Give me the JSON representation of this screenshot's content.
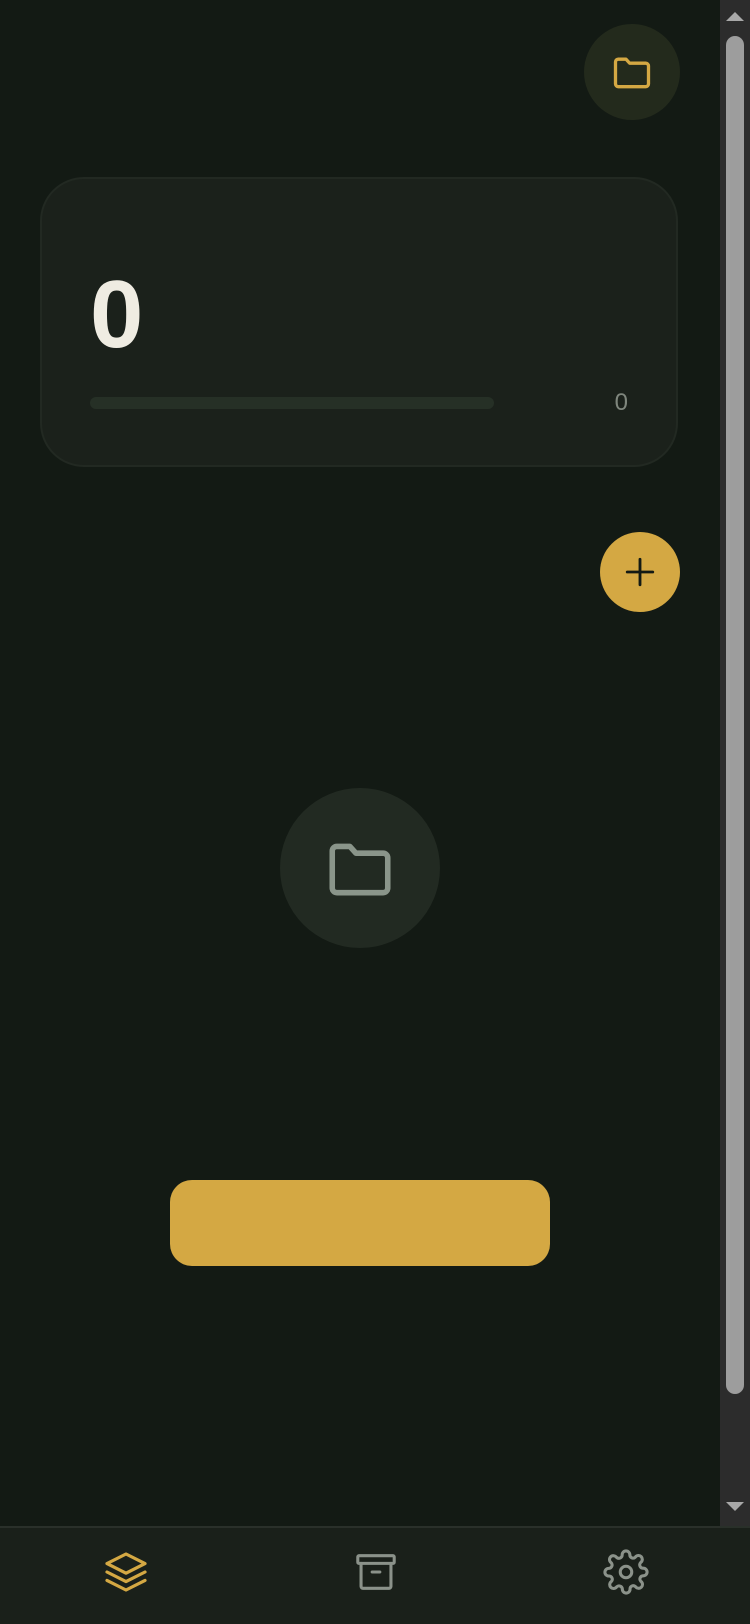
{
  "stats": {
    "count": "0",
    "progress_value": "0",
    "progress_fraction": 0
  },
  "actions": {
    "primary_button_label": ""
  },
  "icons": {
    "top_button": "folder-icon",
    "fab": "plus-icon",
    "empty_state": "folder-icon",
    "nav": [
      "layers-icon",
      "archive-icon",
      "gear-icon"
    ]
  },
  "colors": {
    "background": "#131a14",
    "card": "#1b211b",
    "accent": "#d4a843",
    "muted": "#7f867d",
    "text": "#efece2"
  },
  "nav": {
    "active_index": 0
  }
}
